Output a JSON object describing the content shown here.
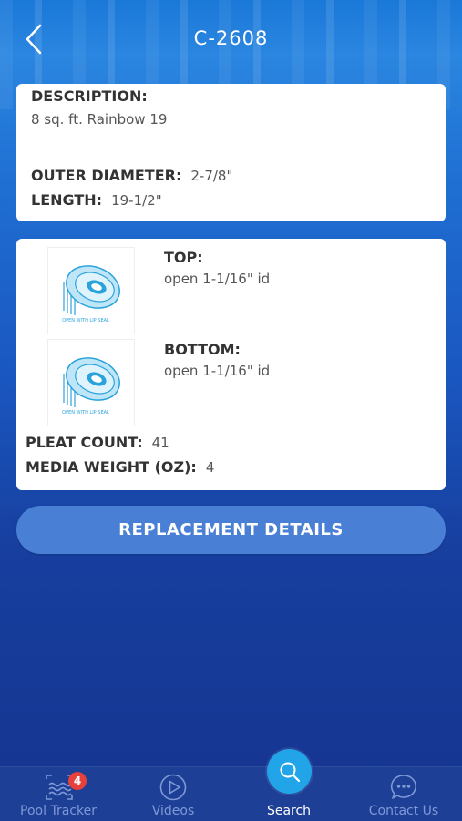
{
  "header": {
    "title": "C-2608"
  },
  "card1": {
    "description_label": "DESCRIPTION:",
    "description_value": "8 sq. ft. Rainbow 19",
    "outer_diameter_label": "OUTER DIAMETER:",
    "outer_diameter_value": "2-7/8\"",
    "length_label": "LENGTH:",
    "length_value": "19-1/2\""
  },
  "card2": {
    "top_label": "TOP:",
    "top_value": "open 1-1/16\" id",
    "bottom_label": "BOTTOM:",
    "bottom_value": "open 1-1/16\" id",
    "thumb_caption": "OPEN WITH LIP SEAL",
    "pleat_count_label": "PLEAT COUNT:",
    "pleat_count_value": "41",
    "media_weight_label": "MEDIA WEIGHT (OZ):",
    "media_weight_value": "4"
  },
  "button": {
    "label": "REPLACEMENT DETAILS"
  },
  "tabbar": {
    "tabs": [
      {
        "label": "Pool Tracker",
        "icon": "pool-tracker-icon",
        "badge": "4"
      },
      {
        "label": "Videos",
        "icon": "play-icon"
      },
      {
        "label": "Search",
        "icon": "search-icon",
        "active": true
      },
      {
        "label": "Contact Us",
        "icon": "chat-bubble-icon"
      }
    ]
  },
  "colors": {
    "accent": "#22a4e8",
    "button": "#4a7fd6",
    "tabbar": "#1d3f96",
    "badge": "#e8403a"
  }
}
